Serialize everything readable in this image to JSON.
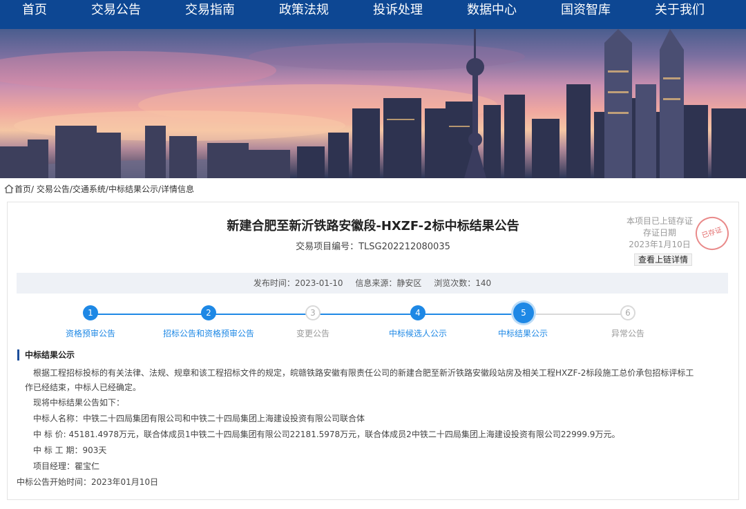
{
  "nav": {
    "items": [
      {
        "label": "首页"
      },
      {
        "label": "交易公告"
      },
      {
        "label": "交易指南"
      },
      {
        "label": "政策法规"
      },
      {
        "label": "投诉处理"
      },
      {
        "label": "数据中心"
      },
      {
        "label": "国资智库"
      },
      {
        "label": "关于我们"
      }
    ]
  },
  "breadcrumb": {
    "items": [
      "首页",
      "/ 交易公告",
      " /交通系统",
      " /中标结果公示",
      " /详情信息"
    ]
  },
  "notice": {
    "title": "新建合肥至新沂铁路安徽段-HXZF-2标中标结果公告",
    "project_no": "交易项目编号：TLSG202212080035"
  },
  "blockchain": {
    "line1": "本项目已上链存证",
    "line2": "存证日期",
    "date": "2023年1月10日",
    "stamp_text": "已存证",
    "button_label": "查看上链详情"
  },
  "meta": {
    "publish": "发布时间：2023-01-10",
    "source": "信息来源：静安区",
    "views": "浏览次数：140"
  },
  "steps": [
    {
      "num": "1",
      "label": "资格预审公告",
      "active": true
    },
    {
      "num": "2",
      "label": "招标公告和资格预审公告",
      "active": true
    },
    {
      "num": "3",
      "label": "变更公告",
      "active": false
    },
    {
      "num": "4",
      "label": "中标候选人公示",
      "active": true
    },
    {
      "num": "5",
      "label": "中标结果公示",
      "active": true,
      "current": true
    },
    {
      "num": "6",
      "label": "异常公告",
      "active": false
    }
  ],
  "section": {
    "heading": "中标结果公示",
    "intro_line1": "根据工程招标投标的有关法律、法规、规章和该工程招标文件的规定，皖赣铁路安徽有限责任公司的新建合肥至新沂铁路安徽段站房及相关工程HXZF-2标段施工总价承包招标评标工",
    "intro_line2": "作已经结束，中标人已经确定。",
    "announce": "现将中标结果公告如下：",
    "winner": "中标人名称：中铁二十四局集团有限公司和中铁二十四局集团上海建设投资有限公司联合体",
    "price": "中 标 价: 45181.4978万元，联合体成员1中铁二十四局集团有限公司22181.5978万元，联合体成员2中铁二十四局集团上海建设投资有限公司22999.9万元。",
    "period": "中 标 工 期：903天",
    "manager": "项目经理：瞿宝仁",
    "start": "中标公告开始时间：2023年01月10日"
  },
  "colors": {
    "nav_bg": "#0d4793",
    "step_active": "#1e88e5",
    "step_inactive": "#d9d9d9"
  }
}
